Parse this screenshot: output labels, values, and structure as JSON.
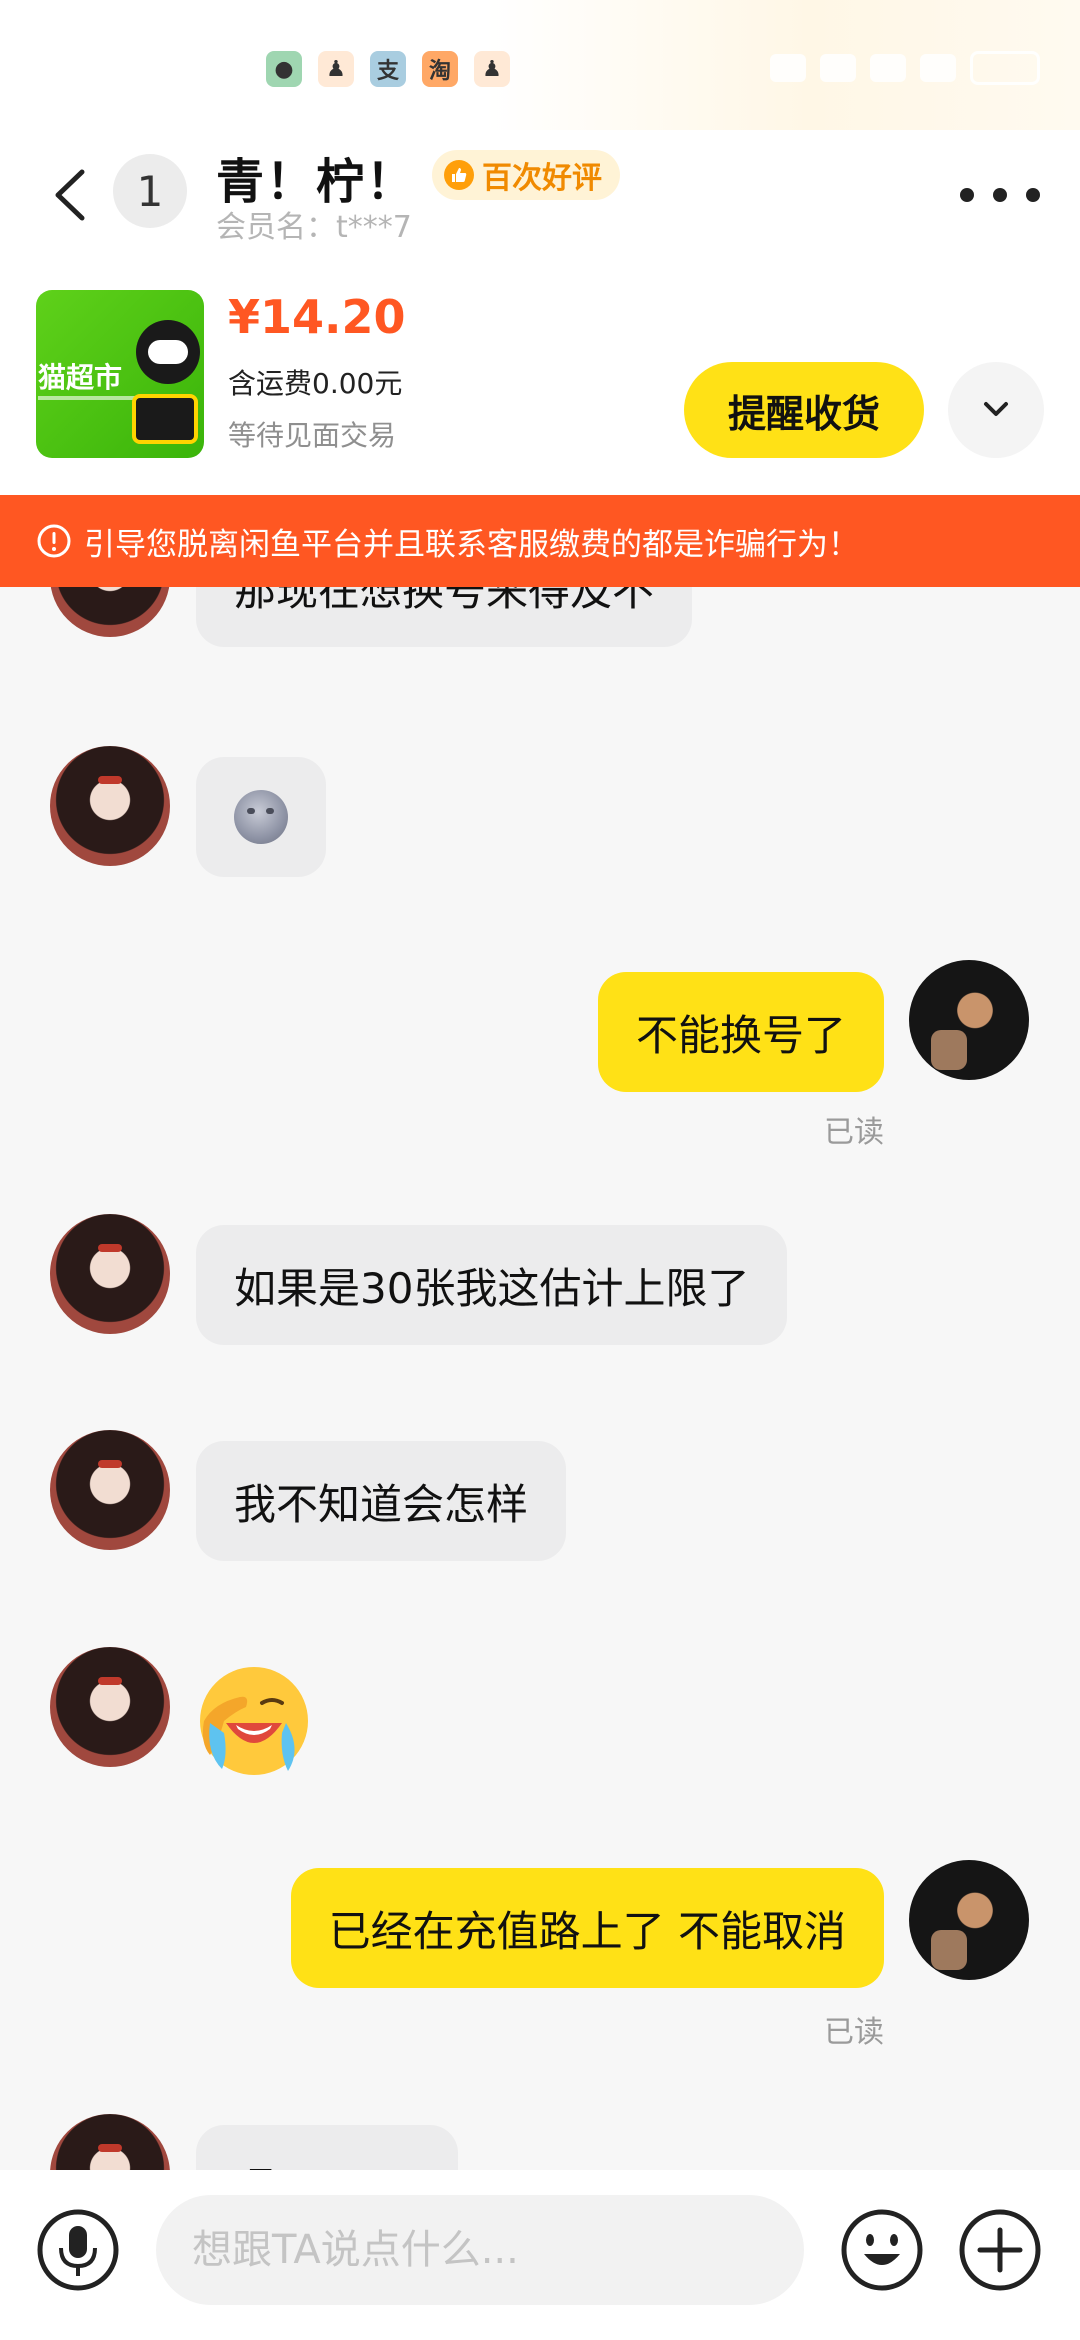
{
  "status_bar": {
    "notification_icons": [
      {
        "name": "wechat-icon",
        "glyph": "●",
        "bg": "#9fd6b1"
      },
      {
        "name": "qq-icon",
        "glyph": "♟",
        "bg": "#ffe9d6"
      },
      {
        "name": "alipay-icon",
        "glyph": "支",
        "bg": "#a9cde0"
      },
      {
        "name": "taobao-icon",
        "glyph": "淘",
        "bg": "#ffa866"
      },
      {
        "name": "qq-icon-2",
        "glyph": "♟",
        "bg": "#ffe9d6"
      }
    ]
  },
  "header": {
    "back_icon": "chevron-left-icon",
    "unread_count": "1",
    "contact_name": "青！柠！",
    "member_label": "会员名：t***7",
    "rating_badge": "百次好评",
    "more_icon": "more-horizontal-icon"
  },
  "order": {
    "price": "¥14.20",
    "shipping": "含运费0.00元",
    "status": "等待见面交易",
    "thumbnail_text": "猫超市",
    "remind_button": "提醒收货",
    "expand_icon": "chevron-down-icon"
  },
  "warning": {
    "text": "引导您脱离闲鱼平台并且联系客服缴费的都是诈骗行为！",
    "icon": "alert-circle-icon"
  },
  "messages": [
    {
      "side": "in",
      "type": "text",
      "text": "那现在想换号来得及不"
    },
    {
      "side": "in",
      "type": "emoji",
      "emoji": "moon-face"
    },
    {
      "side": "out",
      "type": "text",
      "text": "不能换号了",
      "read": "已读"
    },
    {
      "side": "in",
      "type": "text",
      "text": "如果是30张我这估计上限了"
    },
    {
      "side": "in",
      "type": "text",
      "text": "我不知道会怎样"
    },
    {
      "side": "in",
      "type": "emoji",
      "emoji": "crying-face"
    },
    {
      "side": "out",
      "type": "text",
      "text": "已经在充值路上了 不能取消",
      "read": "已读"
    },
    {
      "side": "in",
      "type": "text",
      "text": "嗯"
    }
  ],
  "input_bar": {
    "voice_icon": "microphone-icon",
    "placeholder": "想跟TA说点什么...",
    "emoji_icon": "smiley-icon",
    "plus_icon": "plus-icon"
  },
  "colors": {
    "accent_yellow": "#ffe116",
    "warning_orange": "#ff5722",
    "price_orange": "#ff5722",
    "badge_orange": "#f08a00"
  }
}
